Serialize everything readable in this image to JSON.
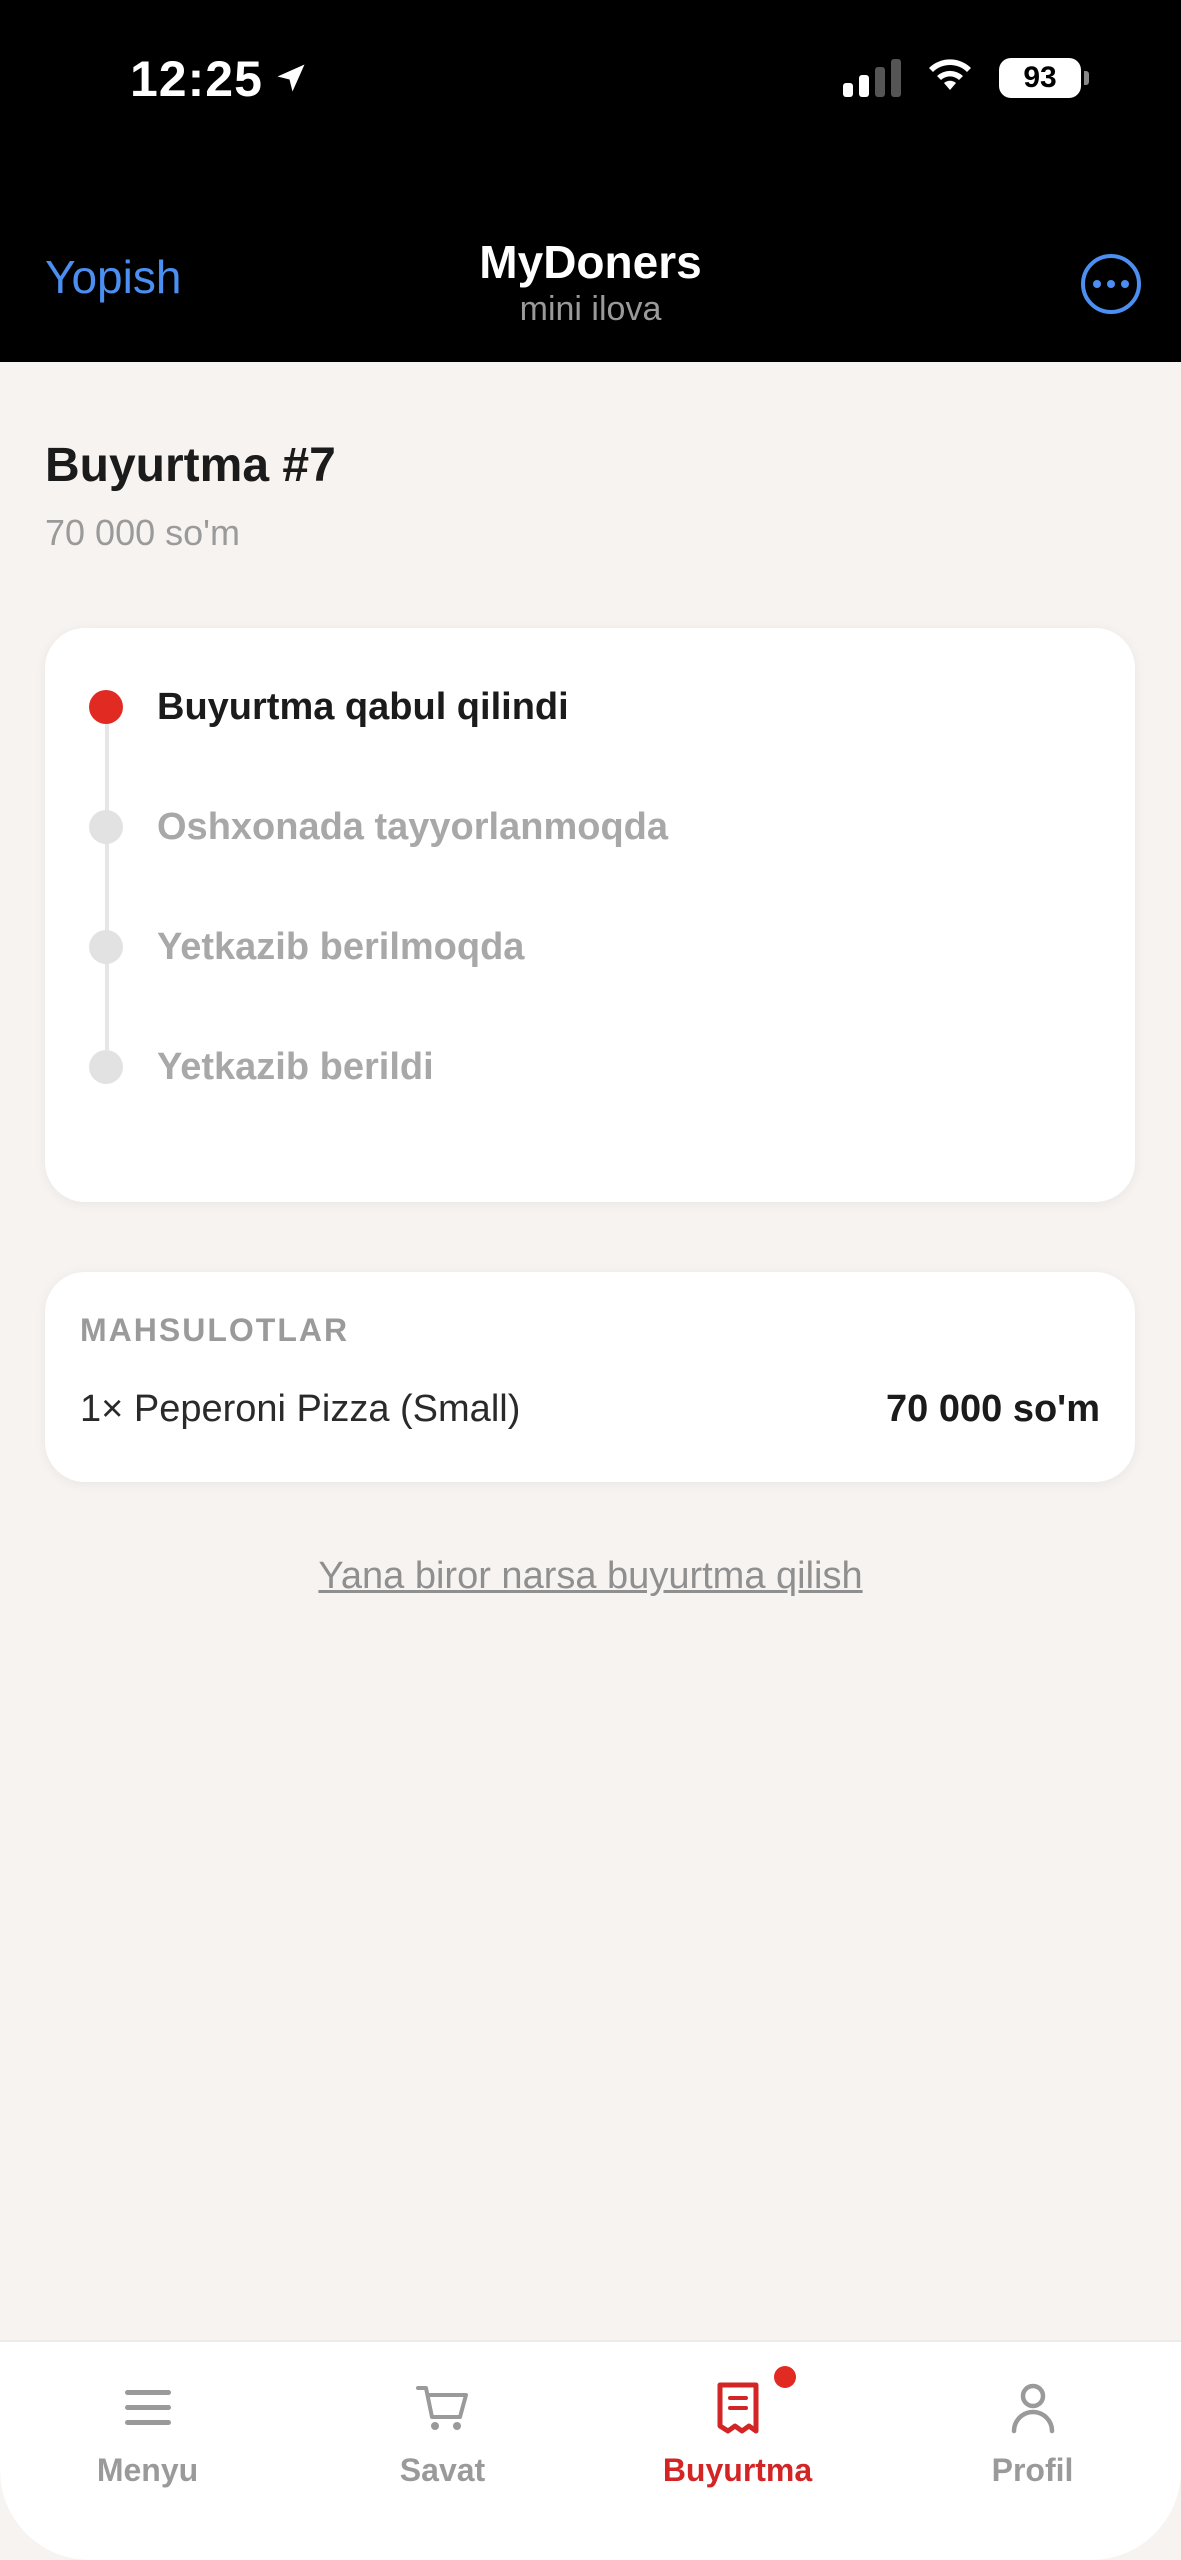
{
  "status_bar": {
    "time": "12:25",
    "battery": "93",
    "icons": [
      "location-arrow-icon",
      "cellular-signal-icon",
      "wifi-icon",
      "battery-icon"
    ]
  },
  "header": {
    "close_label": "Yopish",
    "title": "MyDoners",
    "subtitle": "mini ilova",
    "more_icon": "more-horizontal-icon"
  },
  "order": {
    "title": "Buyurtma #7",
    "total": "70 000 so'm",
    "steps": [
      {
        "label": "Buyurtma qabul qilindi",
        "active": true
      },
      {
        "label": "Oshxonada tayyorlanmoqda",
        "active": false
      },
      {
        "label": "Yetkazib berilmoqda",
        "active": false
      },
      {
        "label": "Yetkazib berildi",
        "active": false
      }
    ],
    "current_step_index": 0
  },
  "products": {
    "heading": "MAHSULOTLAR",
    "items": [
      {
        "name": "1× Peperoni Pizza (Small)",
        "price": "70 000 so'm"
      }
    ]
  },
  "reorder_link": "Yana biror narsa buyurtma qilish",
  "nav": {
    "items": [
      {
        "label": "Menyu",
        "icon": "menu-icon",
        "active": false
      },
      {
        "label": "Savat",
        "icon": "cart-icon",
        "active": false
      },
      {
        "label": "Buyurtma",
        "icon": "receipt-icon",
        "active": true,
        "badge": true
      },
      {
        "label": "Profil",
        "icon": "profile-icon",
        "active": false
      }
    ]
  },
  "colors": {
    "accent_red": "#e02a22",
    "link_blue": "#4a8ff1",
    "background": "#f7f3f1",
    "muted_text": "#9a9a9a"
  }
}
